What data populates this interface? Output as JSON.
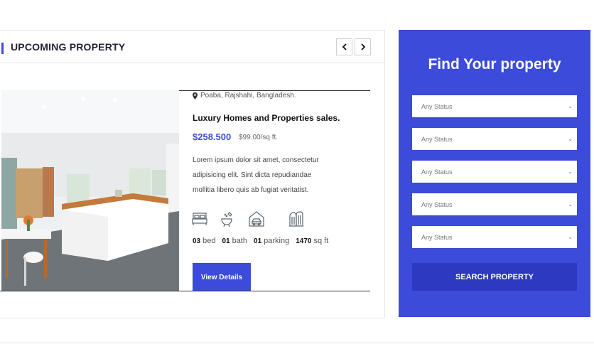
{
  "section": {
    "title": "UPCOMING PROPERTY",
    "prev_icon": "chevron-left-icon",
    "next_icon": "chevron-right-icon"
  },
  "listing": {
    "location": "Poaba, Rajshahi, Bangladesh.",
    "title": "Luxury Homes and Properties sales.",
    "price": "$258.500",
    "price_per_unit": "$99.00/sq ft.",
    "description": "Lorem ipsum dolor sit amet, consectetur adipisicing elit. Sint dicta repudiandae mollitia libero quis ab fugiat veritatist.",
    "features": [
      {
        "icon": "bed-icon",
        "count": "03",
        "label": "bed"
      },
      {
        "icon": "bath-icon",
        "count": "01",
        "label": "bath"
      },
      {
        "icon": "garage-icon",
        "count": "01",
        "label": "parking"
      },
      {
        "icon": "area-icon",
        "count": "1470",
        "label": "sq ft"
      }
    ],
    "button_label": "View Details"
  },
  "search": {
    "title": "Find Your property",
    "selects": [
      {
        "value": "Any Status"
      },
      {
        "value": "Any Status"
      },
      {
        "value": "Any Status"
      },
      {
        "value": "Any Status"
      },
      {
        "value": "Any Status"
      }
    ],
    "button_label": "SEARCH PROPERTY"
  },
  "colors": {
    "accent": "#3c4bd9",
    "accent_dark": "#2d39c0"
  }
}
